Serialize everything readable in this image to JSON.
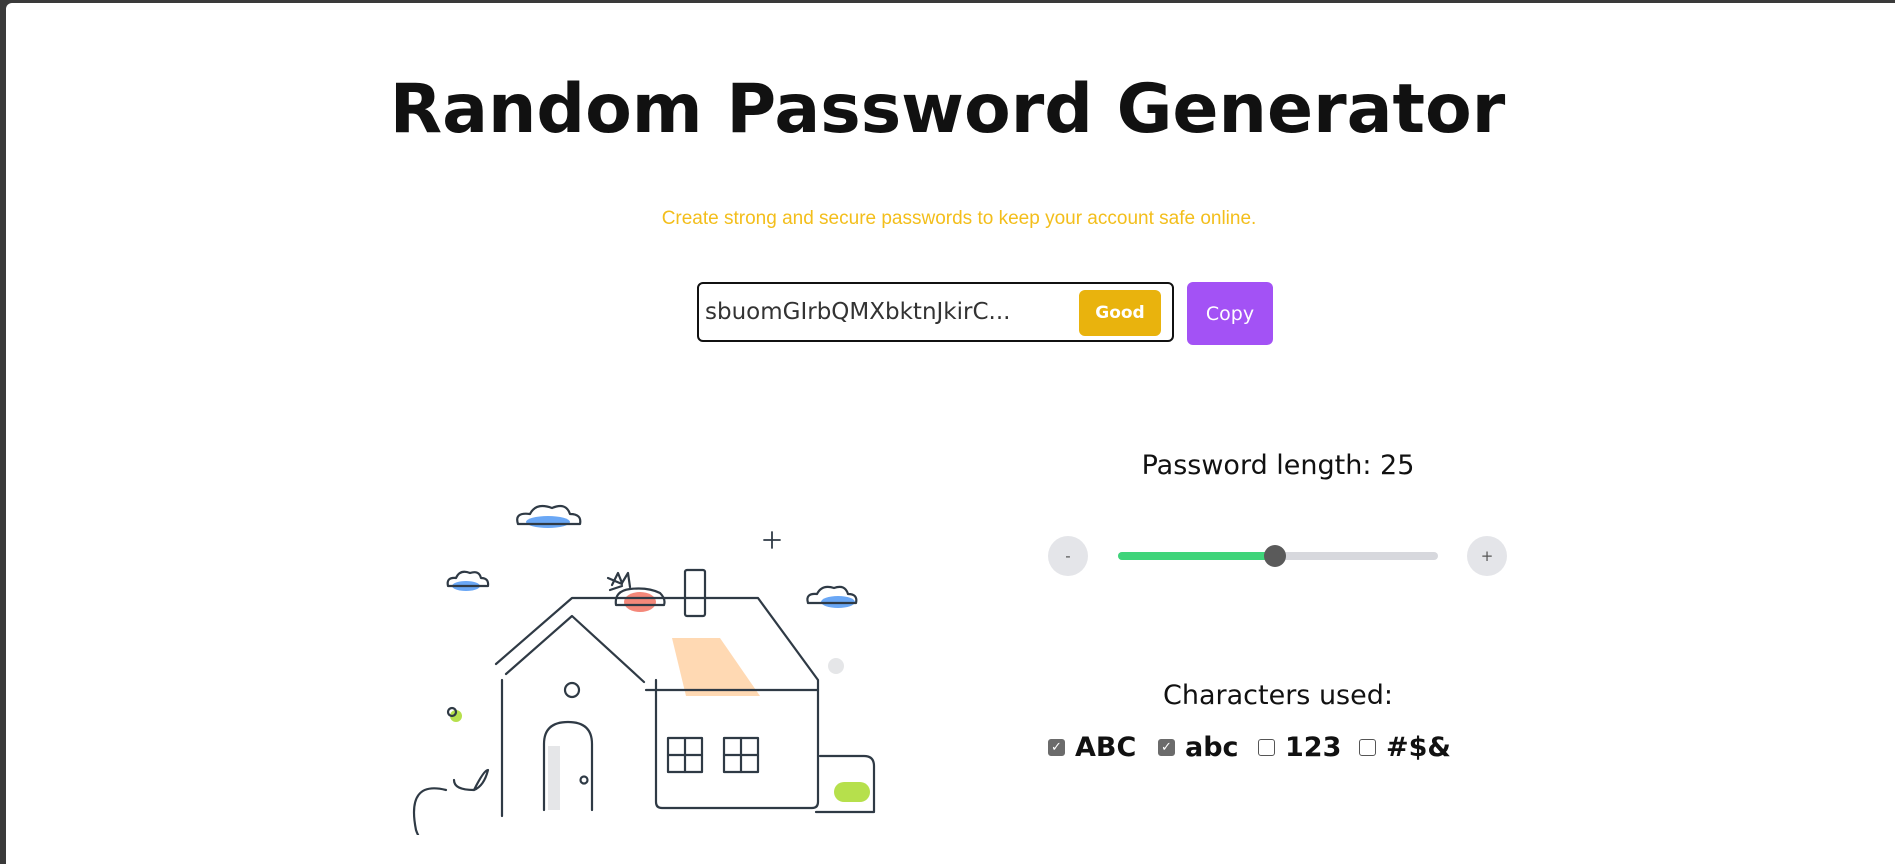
{
  "page": {
    "title": "Random Password Generator",
    "subtitle": "Create strong and secure passwords to keep your account safe online."
  },
  "generator": {
    "password": "sbuomGIrbQMXbktnJkirC...",
    "strength": "Good",
    "copy_label": "Copy"
  },
  "length": {
    "label": "Password length: 25",
    "value": 25,
    "fraction": 0.49,
    "decrease_label": "-",
    "increase_label": "+"
  },
  "characters": {
    "label": "Characters used:",
    "options": [
      {
        "label": "ABC",
        "checked": true
      },
      {
        "label": "abc",
        "checked": true
      },
      {
        "label": "123",
        "checked": false
      },
      {
        "label": "#$&",
        "checked": false
      }
    ]
  },
  "colors": {
    "subtitle": "#f3be1b",
    "strength_badge": "#e9b30d",
    "copy_button": "#a352f5",
    "slider_fill": "#3fd47a"
  }
}
